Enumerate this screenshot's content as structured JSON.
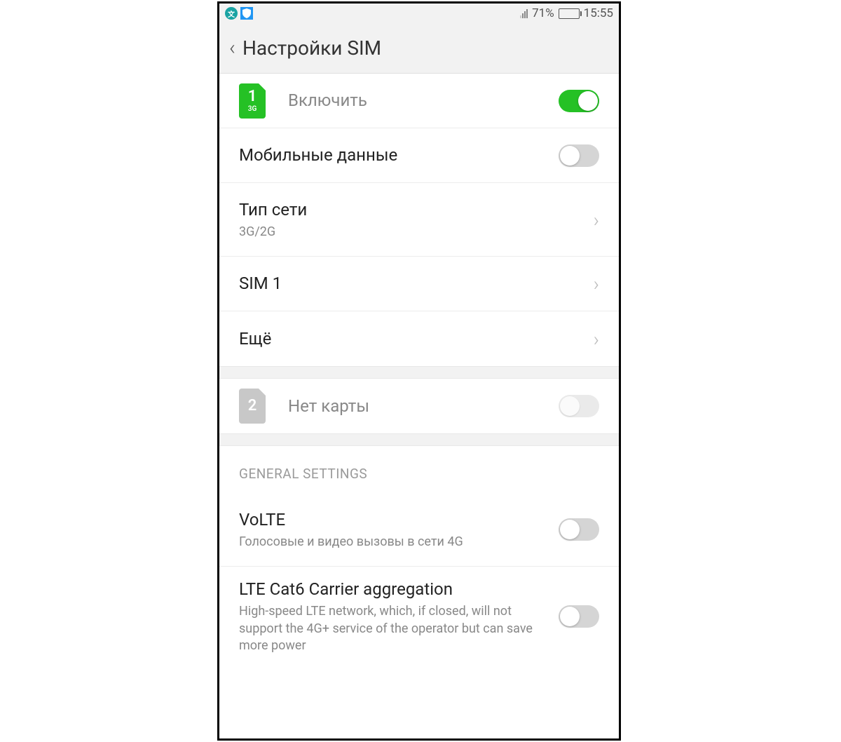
{
  "status_bar": {
    "battery_percent": "71%",
    "time": "15:55"
  },
  "header": {
    "title": "Настройки SIM"
  },
  "sim1": {
    "icon_number": "1",
    "icon_sub": "3G",
    "enable_label": "Включить",
    "enabled": "true"
  },
  "rows": {
    "mobile_data": {
      "title": "Мобильные данные",
      "on": "false"
    },
    "network_type": {
      "title": "Тип сети",
      "value": "3G/2G"
    },
    "sim1_name": {
      "title": "SIM 1"
    },
    "more": {
      "title": "Ещё"
    }
  },
  "sim2": {
    "icon_number": "2",
    "label": "Нет карты"
  },
  "section_header": "GENERAL SETTINGS",
  "volte": {
    "title": "VoLTE",
    "sub": "Голосовые и видео вызовы в сети 4G",
    "on": "false"
  },
  "lte_cat6": {
    "title": "LTE Cat6 Carrier aggregation",
    "sub": "High-speed LTE network, which, if closed, will not support the 4G+ service of the operator but can save more power",
    "on": "false"
  }
}
